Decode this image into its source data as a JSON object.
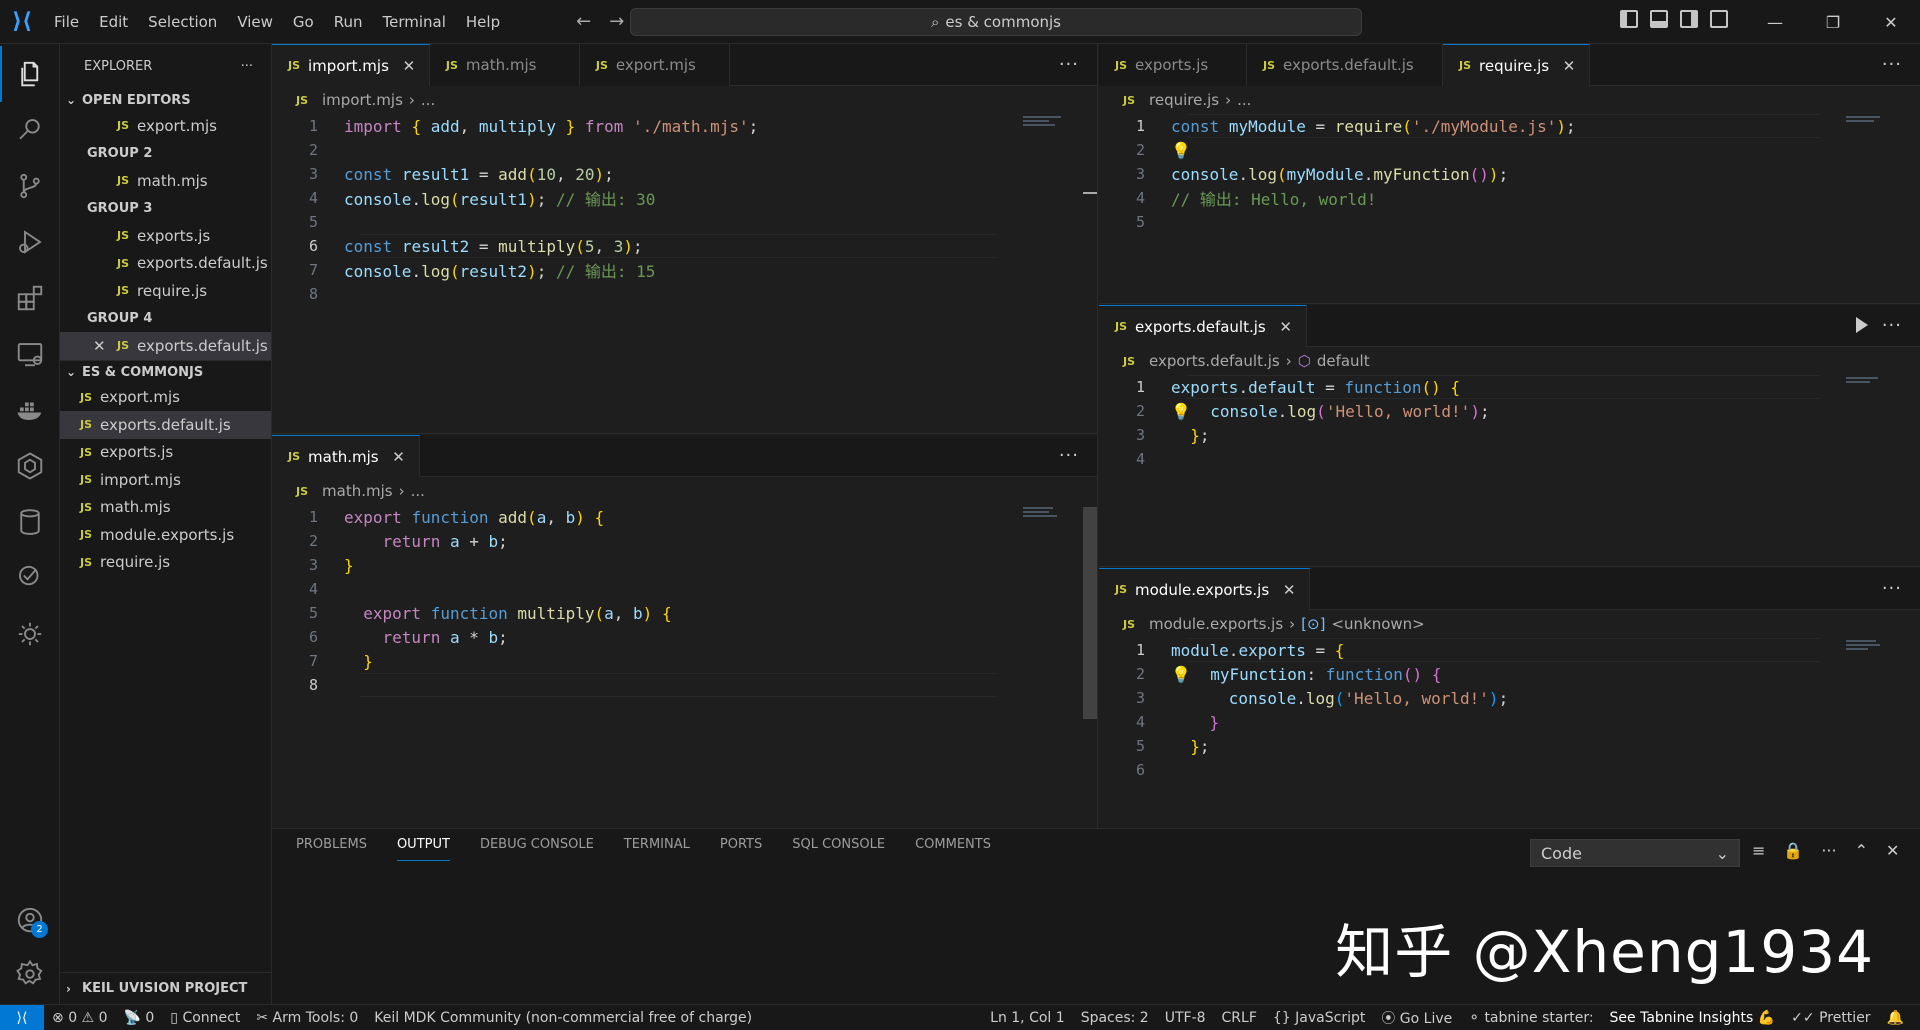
{
  "menu": [
    "File",
    "Edit",
    "Selection",
    "View",
    "Go",
    "Run",
    "Terminal",
    "Help"
  ],
  "command_center": "es & commonjs",
  "sidebar": {
    "title": "EXPLORER",
    "open_editors": "OPEN EDITORS",
    "groups": [
      {
        "label": "",
        "files": [
          "export.mjs"
        ]
      },
      {
        "label": "GROUP 2",
        "files": [
          "math.mjs"
        ]
      },
      {
        "label": "GROUP 3",
        "files": [
          "exports.js",
          "exports.default.js",
          "require.js"
        ]
      },
      {
        "label": "GROUP 4",
        "files": [
          "exports.default.js"
        ]
      }
    ],
    "folder": "ES & COMMONJS",
    "folder_files": [
      "export.mjs",
      "exports.default.js",
      "exports.js",
      "import.mjs",
      "math.mjs",
      "module.exports.js",
      "require.js"
    ],
    "keil": "KEIL UVISION PROJECT"
  },
  "editors": {
    "left_top": {
      "tabs": [
        "import.mjs",
        "math.mjs",
        "export.mjs"
      ],
      "breadcrumb": "import.mjs",
      "breadcrumb_tail": "...",
      "lines": [
        "1",
        "2",
        "3",
        "4",
        "5",
        "6",
        "7",
        "8"
      ]
    },
    "left_bottom": {
      "tabs": [
        "math.mjs"
      ],
      "breadcrumb": "math.mjs",
      "breadcrumb_tail": "...",
      "lines": [
        "1",
        "2",
        "3",
        "4",
        "5",
        "6",
        "7",
        "8"
      ]
    },
    "right_top": {
      "tabs": [
        "exports.js",
        "exports.default.js",
        "require.js"
      ],
      "breadcrumb": "require.js",
      "breadcrumb_tail": "...",
      "lines": [
        "1",
        "2",
        "3",
        "4",
        "5"
      ]
    },
    "right_mid": {
      "tabs": [
        "exports.default.js"
      ],
      "breadcrumb": "exports.default.js",
      "breadcrumb_tail": "default",
      "lines": [
        "1",
        "2",
        "3",
        "4"
      ]
    },
    "right_bottom": {
      "tabs": [
        "module.exports.js"
      ],
      "breadcrumb": "module.exports.js",
      "breadcrumb_tail": "<unknown>",
      "lines": [
        "1",
        "2",
        "3",
        "4",
        "5",
        "6"
      ]
    }
  },
  "panel": {
    "tabs": [
      "PROBLEMS",
      "OUTPUT",
      "DEBUG CONSOLE",
      "TERMINAL",
      "PORTS",
      "SQL CONSOLE",
      "COMMENTS"
    ],
    "active_tab": "OUTPUT",
    "output_channel": "Code"
  },
  "watermark": "知乎 @Xheng1934",
  "accounts_badge": "2",
  "status": {
    "errors": "0",
    "warnings": "0",
    "ports": "0",
    "connect": "Connect",
    "arm_tools": "Arm Tools: 0",
    "keil": "Keil MDK Community (non-commercial free of charge)",
    "position": "Ln 1, Col 1",
    "spaces": "Spaces: 2",
    "encoding": "UTF-8",
    "eol": "CRLF",
    "language": "JavaScript",
    "golive": "Go Live",
    "tabnine": "tabnine starter:",
    "tabnine_link": "See Tabnine Insights",
    "prettier": "Prettier"
  }
}
